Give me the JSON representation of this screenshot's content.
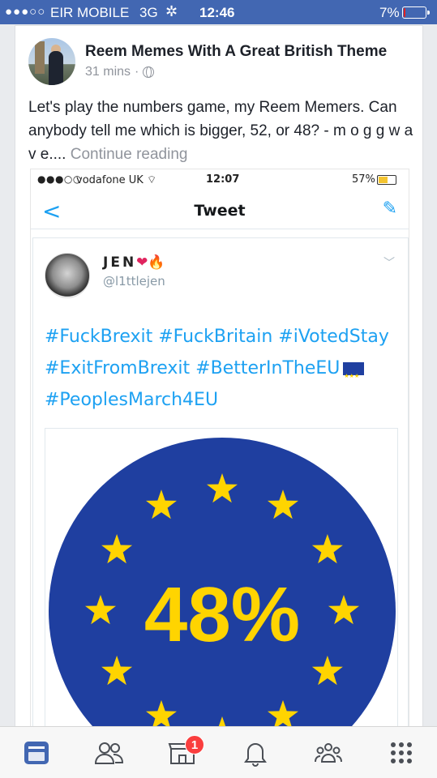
{
  "status_bar": {
    "signal": "●●●○○",
    "carrier": "EIR MOBILE",
    "network": "3G",
    "activity_icon": "spinner-icon",
    "time": "12:46",
    "battery_percent": "7%",
    "battery_level": 0.07
  },
  "post": {
    "page_name": "Reem Memes With A Great British Theme",
    "time": "31 mins",
    "separator": "·",
    "privacy_icon": "globe-icon",
    "text": "Let's play the numbers game, my Reem Memers. Can anybody tell me which is bigger, 52, or 48? - m o g g w a v e.... ",
    "continue_label": "Continue reading"
  },
  "screenshot": {
    "status": {
      "signal": "●●●○○",
      "carrier": "vodafone UK",
      "wifi_icon": "wifi-icon",
      "time": "12:07",
      "battery_percent": "57%",
      "battery_level": 0.57
    },
    "nav": {
      "back": "<",
      "title": "Tweet",
      "compose_icon": "compose-tweet-icon"
    },
    "tweet": {
      "name": "JEN",
      "name_emoji_heart": "❤",
      "name_emoji_fire": "🔥",
      "handle": "@l1ttlejen",
      "hashtags_line1": "#FuckBrexit #FuckBritain #iVotedStay",
      "hashtags_line2": "#ExitFromBrexit #BetterInTheEU",
      "hashtags_line3": "#PeoplesMarch4EU",
      "image_text": "48%"
    }
  },
  "tabbar": {
    "tabs": [
      {
        "icon": "news-feed-icon",
        "active": true
      },
      {
        "icon": "friends-icon"
      },
      {
        "icon": "marketplace-icon",
        "badge": "1"
      },
      {
        "icon": "notifications-bell-icon"
      },
      {
        "icon": "groups-icon"
      },
      {
        "icon": "more-menu-icon"
      }
    ]
  },
  "colors": {
    "facebook_blue": "#4267b2",
    "twitter_blue": "#1da1f2",
    "eu_blue": "#1f3fa0",
    "eu_star": "#ffd400",
    "badge_red": "#fa3e3e"
  }
}
